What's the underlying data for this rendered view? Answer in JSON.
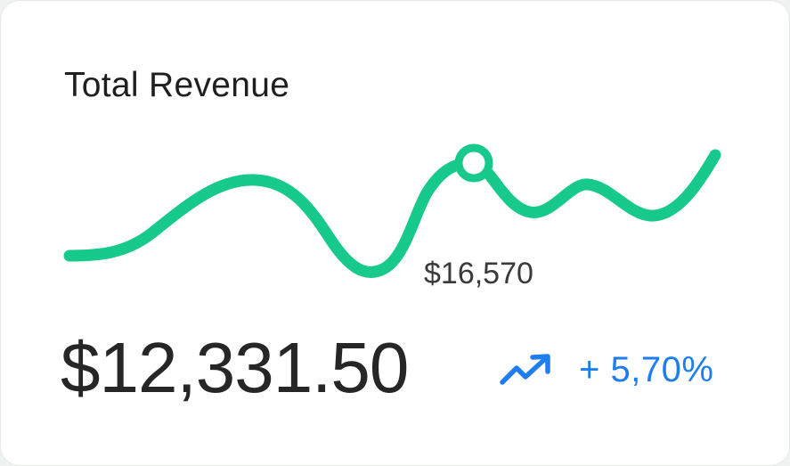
{
  "card": {
    "title": "Total Revenue",
    "total_value": "$12,331.50",
    "change_text": "+ 5,70%",
    "trend_icon": "trend-up-icon"
  },
  "colors": {
    "line": "#17c98a",
    "trend": "#1e7ef0",
    "text": "#232323"
  },
  "chart_data": {
    "type": "line",
    "series": [
      {
        "values": [
          0.0,
          0.02,
          0.2,
          0.45,
          0.4,
          0.0,
          -0.1,
          0.1,
          0.75,
          0.85,
          0.4,
          0.52,
          0.38,
          0.28,
          0.7
        ]
      }
    ],
    "highlight": {
      "index": 9,
      "label": "$16,570"
    },
    "grid": false,
    "legend": "none"
  }
}
